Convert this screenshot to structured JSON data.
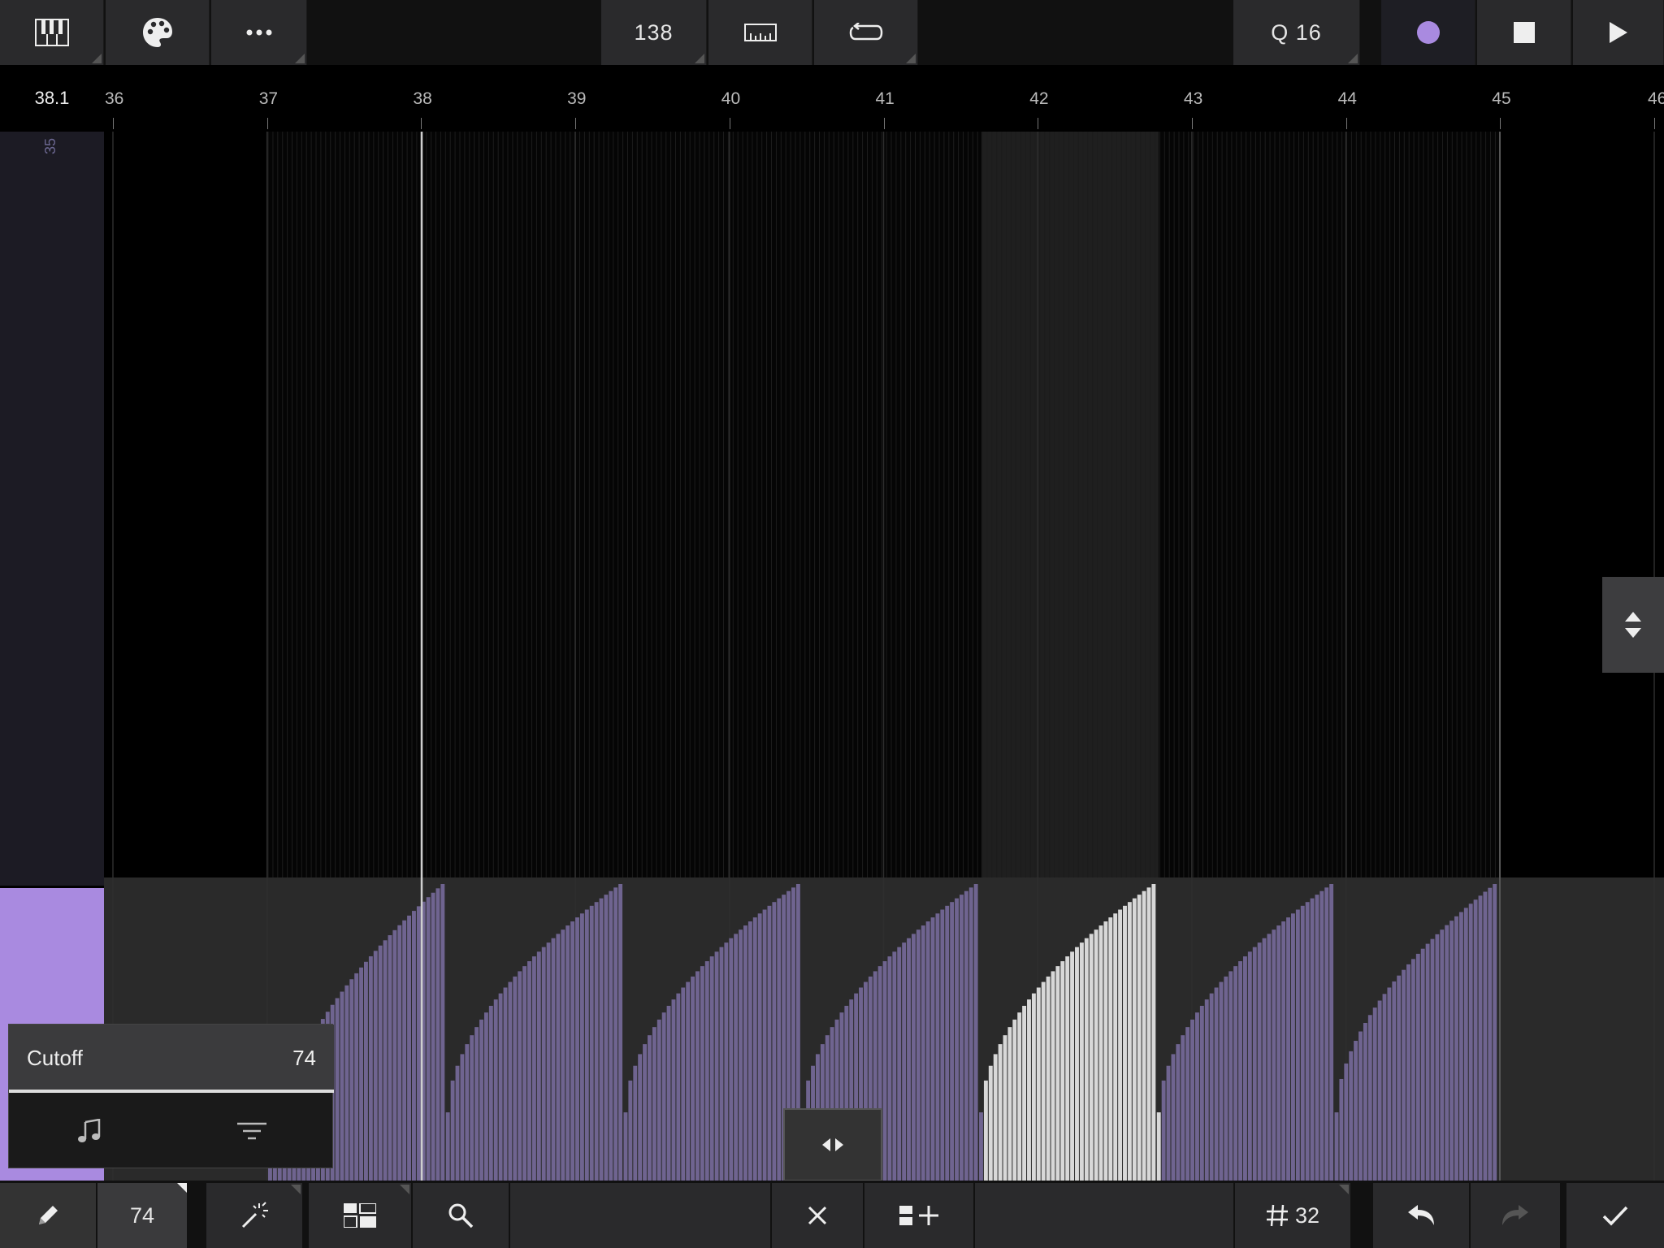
{
  "toolbar": {
    "tempo": "138",
    "quantize": "Q 16"
  },
  "ruler": {
    "position": "38.1",
    "bars": [
      "36",
      "37",
      "38",
      "39",
      "40",
      "41",
      "42",
      "43",
      "44",
      "45",
      "46"
    ]
  },
  "lane": {
    "label": "35"
  },
  "automation": {
    "parameter_name": "Cutoff",
    "parameter_cc": "74",
    "colors": {
      "accent": "#a98ae0",
      "fill": "#6f6490",
      "selected": "#d8d8d8"
    }
  },
  "bottombar": {
    "cc_value": "74",
    "grid_count": "32"
  },
  "icons": {
    "top": [
      "piano-keys-icon",
      "palette-icon",
      "more-icon",
      "metronome-ruler-icon",
      "loop-icon",
      "record-icon",
      "stop-icon",
      "play-icon"
    ],
    "bottom": [
      "pencil-icon",
      "magic-wand-icon",
      "layout-icon",
      "search-icon",
      "close-icon",
      "add-track-icon",
      "grid-icon",
      "undo-icon",
      "redo-icon",
      "check-icon"
    ]
  }
}
